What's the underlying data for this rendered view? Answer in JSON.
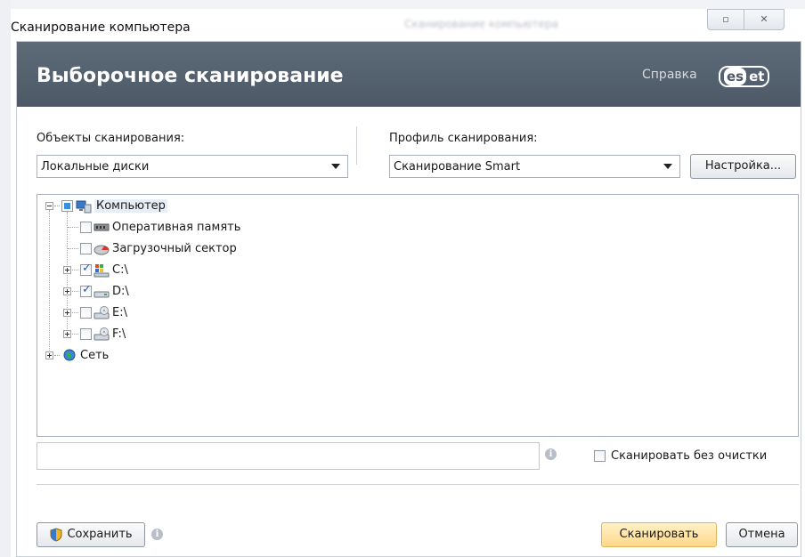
{
  "window": {
    "title": "Сканирование компьютера",
    "restore_icon": "restore-icon",
    "close_icon": "close-icon"
  },
  "header": {
    "title": "Выборочное сканирование",
    "help_label": "Справка",
    "logo": "eset"
  },
  "targets": {
    "label": "Объекты сканирования:",
    "selected": "Локальные диски"
  },
  "profile": {
    "label": "Профиль сканирования:",
    "selected": "Сканирование Smart",
    "setup_button": "Настройка..."
  },
  "tree": {
    "root": {
      "label": "Компьютер",
      "icon": "computer-icon",
      "state": "partial"
    },
    "items": [
      {
        "label": "Оперативная память",
        "icon": "memory-icon",
        "checked": false
      },
      {
        "label": "Загрузочный сектор",
        "icon": "boot-sector-icon",
        "checked": false
      },
      {
        "label": "C:\\",
        "icon": "system-drive-icon",
        "checked": true
      },
      {
        "label": "D:\\",
        "icon": "hard-drive-icon",
        "checked": true
      },
      {
        "label": "E:\\",
        "icon": "cd-drive-icon",
        "checked": false
      },
      {
        "label": "F:\\",
        "icon": "cd-drive-icon",
        "checked": false
      }
    ],
    "network": {
      "label": "Сеть",
      "icon": "network-icon"
    }
  },
  "scan_no_clean": {
    "label": "Сканировать без очистки",
    "checked": false
  },
  "footer": {
    "save_button": "Сохранить",
    "scan_button": "Сканировать",
    "cancel_button": "Отмена"
  },
  "colors": {
    "header_bg": "#55616e",
    "primary_button": "#ffd88a",
    "check": "#2a5ac8"
  }
}
